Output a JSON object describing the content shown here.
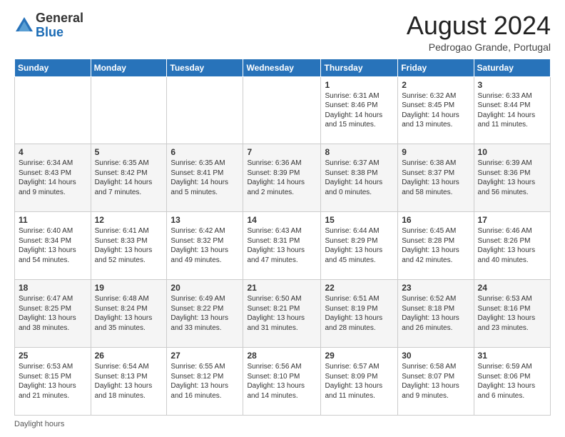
{
  "logo": {
    "general": "General",
    "blue": "Blue"
  },
  "title": "August 2024",
  "location": "Pedrogao Grande, Portugal",
  "header_days": [
    "Sunday",
    "Monday",
    "Tuesday",
    "Wednesday",
    "Thursday",
    "Friday",
    "Saturday"
  ],
  "footer": "Daylight hours",
  "weeks": [
    [
      {
        "day": "",
        "info": ""
      },
      {
        "day": "",
        "info": ""
      },
      {
        "day": "",
        "info": ""
      },
      {
        "day": "",
        "info": ""
      },
      {
        "day": "1",
        "info": "Sunrise: 6:31 AM\nSunset: 8:46 PM\nDaylight: 14 hours and 15 minutes."
      },
      {
        "day": "2",
        "info": "Sunrise: 6:32 AM\nSunset: 8:45 PM\nDaylight: 14 hours and 13 minutes."
      },
      {
        "day": "3",
        "info": "Sunrise: 6:33 AM\nSunset: 8:44 PM\nDaylight: 14 hours and 11 minutes."
      }
    ],
    [
      {
        "day": "4",
        "info": "Sunrise: 6:34 AM\nSunset: 8:43 PM\nDaylight: 14 hours and 9 minutes."
      },
      {
        "day": "5",
        "info": "Sunrise: 6:35 AM\nSunset: 8:42 PM\nDaylight: 14 hours and 7 minutes."
      },
      {
        "day": "6",
        "info": "Sunrise: 6:35 AM\nSunset: 8:41 PM\nDaylight: 14 hours and 5 minutes."
      },
      {
        "day": "7",
        "info": "Sunrise: 6:36 AM\nSunset: 8:39 PM\nDaylight: 14 hours and 2 minutes."
      },
      {
        "day": "8",
        "info": "Sunrise: 6:37 AM\nSunset: 8:38 PM\nDaylight: 14 hours and 0 minutes."
      },
      {
        "day": "9",
        "info": "Sunrise: 6:38 AM\nSunset: 8:37 PM\nDaylight: 13 hours and 58 minutes."
      },
      {
        "day": "10",
        "info": "Sunrise: 6:39 AM\nSunset: 8:36 PM\nDaylight: 13 hours and 56 minutes."
      }
    ],
    [
      {
        "day": "11",
        "info": "Sunrise: 6:40 AM\nSunset: 8:34 PM\nDaylight: 13 hours and 54 minutes."
      },
      {
        "day": "12",
        "info": "Sunrise: 6:41 AM\nSunset: 8:33 PM\nDaylight: 13 hours and 52 minutes."
      },
      {
        "day": "13",
        "info": "Sunrise: 6:42 AM\nSunset: 8:32 PM\nDaylight: 13 hours and 49 minutes."
      },
      {
        "day": "14",
        "info": "Sunrise: 6:43 AM\nSunset: 8:31 PM\nDaylight: 13 hours and 47 minutes."
      },
      {
        "day": "15",
        "info": "Sunrise: 6:44 AM\nSunset: 8:29 PM\nDaylight: 13 hours and 45 minutes."
      },
      {
        "day": "16",
        "info": "Sunrise: 6:45 AM\nSunset: 8:28 PM\nDaylight: 13 hours and 42 minutes."
      },
      {
        "day": "17",
        "info": "Sunrise: 6:46 AM\nSunset: 8:26 PM\nDaylight: 13 hours and 40 minutes."
      }
    ],
    [
      {
        "day": "18",
        "info": "Sunrise: 6:47 AM\nSunset: 8:25 PM\nDaylight: 13 hours and 38 minutes."
      },
      {
        "day": "19",
        "info": "Sunrise: 6:48 AM\nSunset: 8:24 PM\nDaylight: 13 hours and 35 minutes."
      },
      {
        "day": "20",
        "info": "Sunrise: 6:49 AM\nSunset: 8:22 PM\nDaylight: 13 hours and 33 minutes."
      },
      {
        "day": "21",
        "info": "Sunrise: 6:50 AM\nSunset: 8:21 PM\nDaylight: 13 hours and 31 minutes."
      },
      {
        "day": "22",
        "info": "Sunrise: 6:51 AM\nSunset: 8:19 PM\nDaylight: 13 hours and 28 minutes."
      },
      {
        "day": "23",
        "info": "Sunrise: 6:52 AM\nSunset: 8:18 PM\nDaylight: 13 hours and 26 minutes."
      },
      {
        "day": "24",
        "info": "Sunrise: 6:53 AM\nSunset: 8:16 PM\nDaylight: 13 hours and 23 minutes."
      }
    ],
    [
      {
        "day": "25",
        "info": "Sunrise: 6:53 AM\nSunset: 8:15 PM\nDaylight: 13 hours and 21 minutes."
      },
      {
        "day": "26",
        "info": "Sunrise: 6:54 AM\nSunset: 8:13 PM\nDaylight: 13 hours and 18 minutes."
      },
      {
        "day": "27",
        "info": "Sunrise: 6:55 AM\nSunset: 8:12 PM\nDaylight: 13 hours and 16 minutes."
      },
      {
        "day": "28",
        "info": "Sunrise: 6:56 AM\nSunset: 8:10 PM\nDaylight: 13 hours and 14 minutes."
      },
      {
        "day": "29",
        "info": "Sunrise: 6:57 AM\nSunset: 8:09 PM\nDaylight: 13 hours and 11 minutes."
      },
      {
        "day": "30",
        "info": "Sunrise: 6:58 AM\nSunset: 8:07 PM\nDaylight: 13 hours and 9 minutes."
      },
      {
        "day": "31",
        "info": "Sunrise: 6:59 AM\nSunset: 8:06 PM\nDaylight: 13 hours and 6 minutes."
      }
    ]
  ]
}
